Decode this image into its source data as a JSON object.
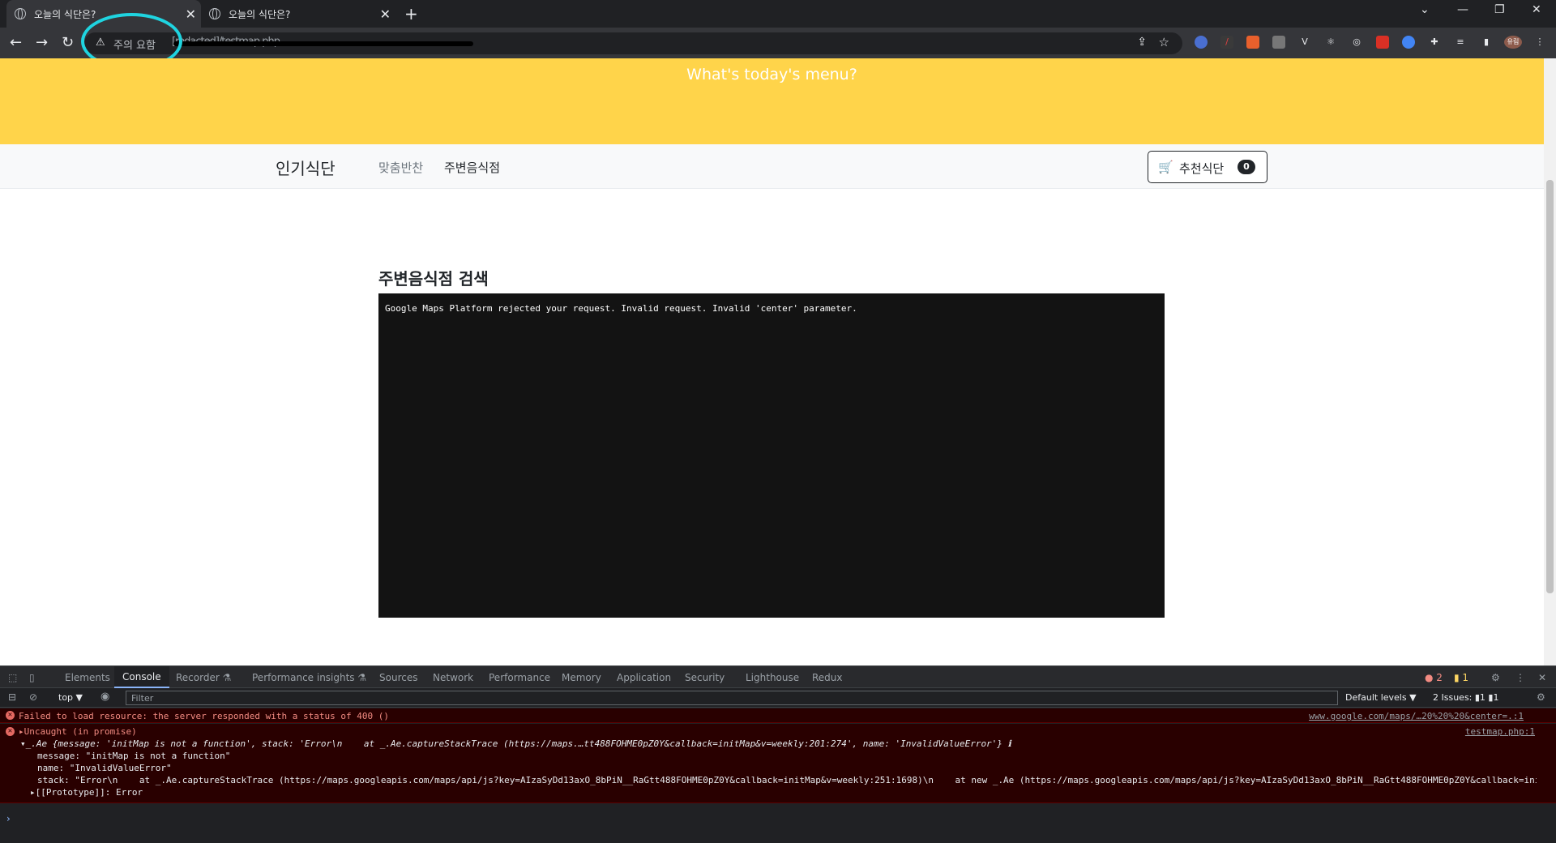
{
  "browser": {
    "tabs": [
      {
        "title": "오늘의 식단은?",
        "active": true
      },
      {
        "title": "오늘의 식단은?",
        "active": false
      }
    ],
    "new_tab": "+",
    "window_controls": [
      "⌄",
      "—",
      "❐",
      "✕"
    ],
    "security_label": "주의 요함",
    "url": "[redacted]/testmap.php",
    "extensions_profile": "유림"
  },
  "page": {
    "banner_title": "What's today's menu?",
    "nav": {
      "brand": "인기식단",
      "links": [
        "맞춤반찬",
        "주변음식점"
      ]
    },
    "cart": {
      "label": "추천식단",
      "count": "0"
    },
    "section_heading": "주변음식점 검색",
    "map_error": "Google Maps Platform rejected your request. Invalid request. Invalid 'center' parameter."
  },
  "devtools": {
    "tabs": [
      "Elements",
      "Console",
      "Recorder ⚗",
      "Performance insights ⚗",
      "Sources",
      "Network",
      "Performance",
      "Memory",
      "Application",
      "Security",
      "Lighthouse",
      "Redux"
    ],
    "active_tab": "Console",
    "error_count": "2",
    "warning_count": "1",
    "context": "top ▼",
    "filter_placeholder": "Filter",
    "levels": "Default levels ▼",
    "issues": "2 Issues: ▮1 ▮1",
    "messages": [
      {
        "text": "Failed to load resource: the server responded with a status of 400 ()",
        "source": "www.google.com/maps/…20%20%20&center=.:1"
      },
      {
        "text": "▸Uncaught (in promise)",
        "source": "testmap.php:1",
        "details": [
          "▾_.Ae {message: 'initMap is not a function', stack: 'Error\\n    at _.Ae.captureStackTrace (https://maps.…tt488FOHME0pZ0Y&callback=initMap&v=weekly:201:274', name: 'InvalidValueError'} ℹ",
          "message: \"initMap is not a function\"",
          "name: \"InvalidValueError\"",
          "stack: \"Error\\n    at _.Ae.captureStackTrace (https://maps.googleapis.com/maps/api/js?key=AIzaSyDd13axO_8bPiN__RaGtt488FOHME0pZ0Y&callback=initMap&v=weekly:251:1698)\\n    at new _.Ae (https://maps.googleapis.com/maps/api/js?key=AIzaSyDd13axO_8bPiN__RaGtt488FOHME0pZ0Y&callback=initMi",
          "▸[[Prototype]]: Error"
        ]
      }
    ],
    "prompt": "›"
  }
}
